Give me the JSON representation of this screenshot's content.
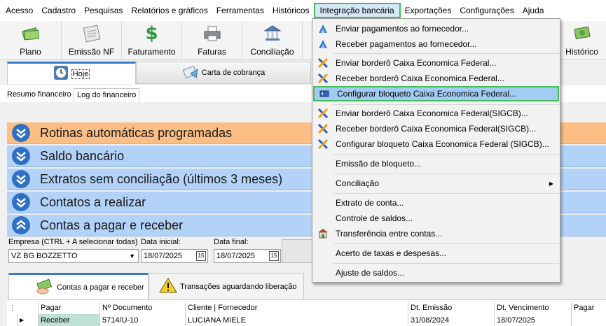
{
  "menubar": {
    "items": [
      "Acesso",
      "Cadastro",
      "Pesquisas",
      "Relatórios e gráficos",
      "Ferramentas",
      "Históricos",
      "Integração bancária",
      "Exportações",
      "Configurações",
      "Ajuda"
    ]
  },
  "toolbar": {
    "buttons": [
      "Plano",
      "Emissão NF",
      "Faturamento",
      "Faturas",
      "Conciliação"
    ],
    "historico": "Histórico"
  },
  "main_tabs": [
    "Hoje",
    "Carta de cobrança"
  ],
  "sub_tabs": [
    "Resumo financeiro",
    "Log do financeiro"
  ],
  "panels": [
    "Rotinas automáticas programadas",
    "Saldo bancário",
    "Extratos sem conciliação (últimos 3 meses)",
    "Contatos a realizar",
    "Contas a pagar e receber"
  ],
  "filters": {
    "empresa_label": "Empresa (CTRL + A selecionar todas)",
    "empresa_value": "VZ BG BOZZETTO",
    "data_inicial_label": "Data inicial:",
    "data_inicial_value": "18/07/2025",
    "data_final_label": "Data final:",
    "data_final_value": "18/07/2025",
    "cal_glyph": "15"
  },
  "bottom_tabs": [
    "Contas a pagar e receber",
    "Transações aguardando liberação"
  ],
  "grid": {
    "headers": [
      "Pagar",
      "Nº Documento",
      "Cliente | Fornecedor",
      "Dt. Emissão",
      "Dt. Vencimento",
      "Pagar"
    ],
    "row": [
      "Receber",
      "5714/U-10",
      "LUCIANA MIELE",
      "31/08/2024",
      "18/07/2025",
      ""
    ]
  },
  "dropdown": {
    "items": [
      "Enviar pagamentos ao fornecedor...",
      "Receber pagamentos ao fornecedor...",
      "Enviar borderô Caixa Economica Federal...",
      "Receber borderô Caixa Economica Federal...",
      "Configurar bloqueto Caixa Economica Federal...",
      "Enviar borderô Caixa Economica Federal(SIGCB)...",
      "Receber borderô Caixa Economica Federal(SIGCB)...",
      "Configurar bloqueto Caixa Economica Federal (SIGCB)...",
      "Emissão de bloqueto...",
      "Conciliação",
      "Extrato de conta...",
      "Controle de saldos...",
      "Transferência entre contas...",
      "Acerto de taxas e despesas...",
      "Ajuste de saldos..."
    ]
  },
  "colors": {
    "highlight_border": "#3fbf55",
    "panel_orange": "#fbbe84",
    "panel_blue": "#b2d2f7",
    "selected_item": "#a3cbf3"
  }
}
